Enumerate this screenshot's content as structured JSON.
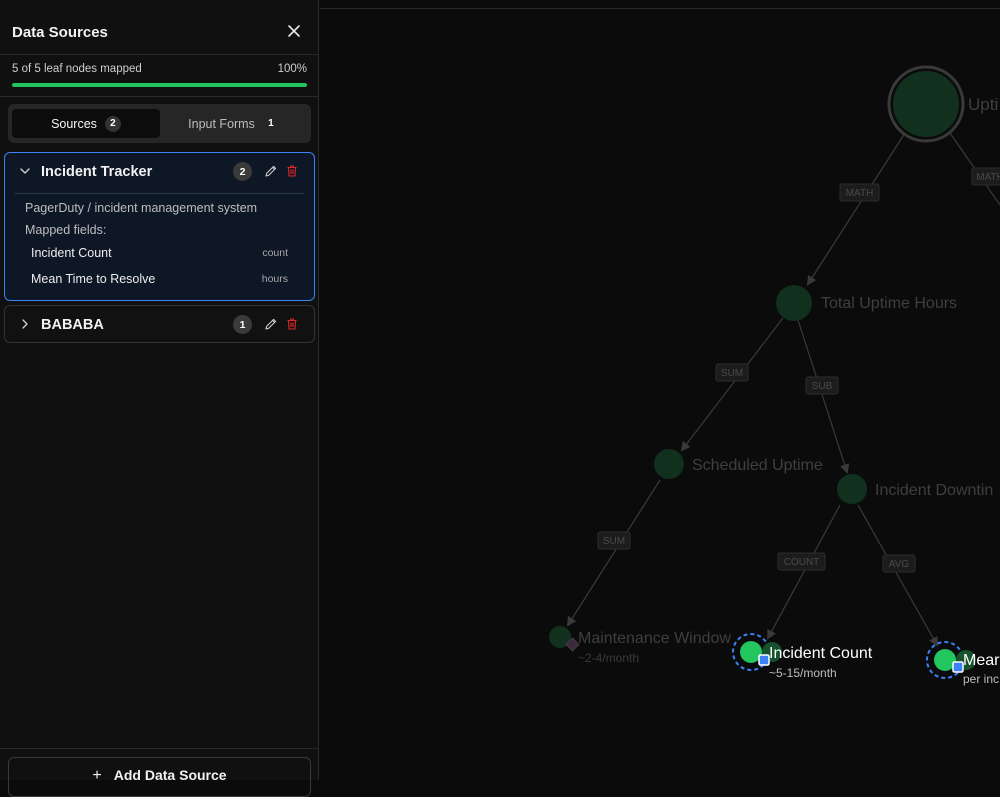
{
  "sidebar": {
    "title": "Data Sources",
    "progress": {
      "text": "5 of 5 leaf nodes mapped",
      "percent_label": "100%",
      "fraction": 1.0
    },
    "tabs": [
      {
        "label": "Sources",
        "count": "2"
      },
      {
        "label": "Input Forms",
        "count": "1"
      }
    ],
    "sources": [
      {
        "name": "Incident Tracker",
        "count": "2",
        "description": "PagerDuty / incident management system",
        "mapped_label": "Mapped fields:",
        "fields": [
          {
            "name": "Incident Count",
            "unit": "count"
          },
          {
            "name": "Mean Time to Resolve",
            "unit": "hours"
          }
        ]
      },
      {
        "name": "BABABA",
        "count": "1"
      }
    ],
    "add_button": {
      "icon": "plus-icon",
      "label": "Add Data Source"
    }
  },
  "graph": {
    "nodes": {
      "root": "Upti",
      "total_uptime": "Total Uptime Hours",
      "scheduled_uptime": "Scheduled Uptime",
      "incident_downtime": "Incident Downtin",
      "maintenance": "Maintenance Window",
      "maintenance_sub": "~2-4/month",
      "incident_count": "Incident Count",
      "incident_count_sub": "~5-15/month",
      "mttr": "Mear",
      "mttr_sub": "per inc"
    },
    "edges": {
      "root_total": "MATH",
      "root_right": "MATH",
      "total_scheduled": "SUM",
      "total_incident": "SUB",
      "scheduled_maint": "SUM",
      "incident_count": "COUNT",
      "incident_mttr": "AVG"
    },
    "colors": {
      "node": "#22c55e",
      "dim_node": "#14532d",
      "mapped_ring": "#3b82f6",
      "delete": "#dc2626"
    }
  }
}
